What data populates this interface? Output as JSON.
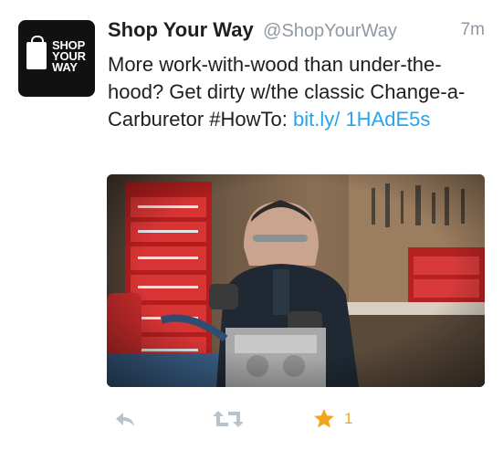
{
  "tweet": {
    "avatar": {
      "line1": "SHOP",
      "line2": "YOUR",
      "line3": "WAY"
    },
    "display_name": "Shop Your Way",
    "handle": "@ShopYourWay",
    "time": "7m",
    "text_main": "More work-with-wood than under-the-hood? Get dirty w/the classic Change-a-Carburetor #HowTo: ",
    "text_link": "bit.ly/ 1HAdE5s",
    "media": {
      "icon": "photo"
    },
    "actions": {
      "reply_icon": "reply-icon",
      "retweet_icon": "retweet-icon",
      "favorite_icon": "star-icon",
      "favorite_count": "1"
    }
  },
  "colors": {
    "link": "#2aa3ef",
    "muted": "#8f99a3",
    "favorite": "#f2a51b"
  }
}
